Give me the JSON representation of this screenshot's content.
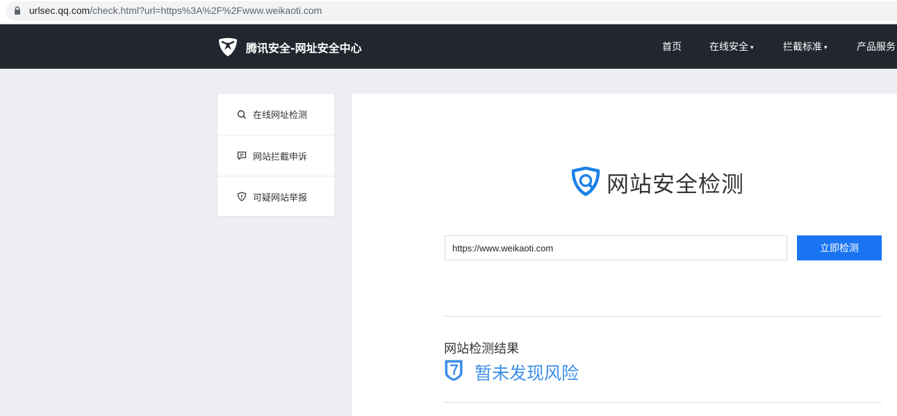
{
  "browser": {
    "url_host": "urlsec.qq.com",
    "url_rest": "/check.html?url=https%3A%2F%2Fwww.weikaoti.com"
  },
  "header": {
    "brand": "腾讯安全-网址安全中心",
    "nav": [
      {
        "label": "首页",
        "has_dropdown": false
      },
      {
        "label": "在线安全",
        "has_dropdown": true
      },
      {
        "label": "拦截标准",
        "has_dropdown": true
      },
      {
        "label": "产品服务",
        "has_dropdown": false
      }
    ],
    "caret": "▾"
  },
  "sidebar": {
    "items": [
      {
        "label": "在线网址检测",
        "icon": "search-icon"
      },
      {
        "label": "网站拦截申诉",
        "icon": "message-icon"
      },
      {
        "label": "可疑网站举报",
        "icon": "shield-alert-icon"
      }
    ]
  },
  "main": {
    "title": "网站安全检测",
    "url_value": "https://www.weikaoti.com",
    "check_button": "立即检测",
    "result_heading": "网站检测结果",
    "result_status": "暂未发现风险"
  },
  "colors": {
    "header_bg": "#22262f",
    "accent_blue": "#1a74f2",
    "result_blue": "#3d8ee8",
    "page_bg": "#efeff3"
  }
}
